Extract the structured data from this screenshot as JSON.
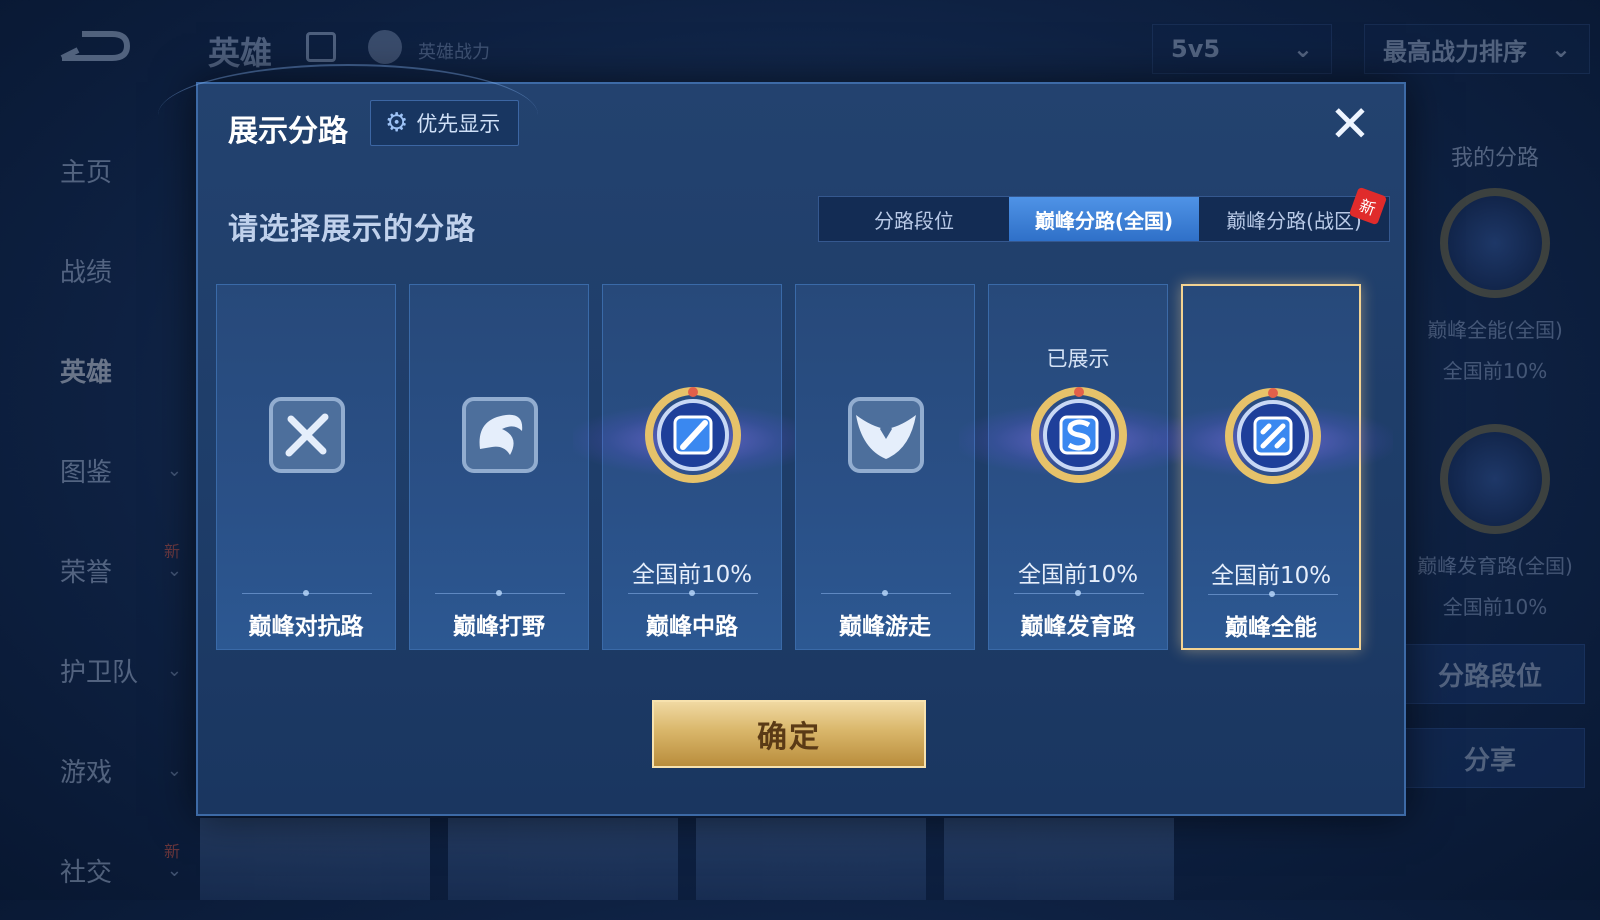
{
  "background": {
    "title": "英雄",
    "power_label": "英雄战力",
    "mode_select": "5v5",
    "sort_select": "最高战力排序",
    "sidebar": [
      {
        "label": "主页"
      },
      {
        "label": "战绩"
      },
      {
        "label": "英雄"
      },
      {
        "label": "图鉴"
      },
      {
        "label": "荣誉"
      },
      {
        "label": "护卫队"
      },
      {
        "label": "游戏"
      },
      {
        "label": "社交"
      }
    ],
    "new_tag": "新",
    "right_panel": {
      "my_lane_label": "我的分路",
      "badge1_name": "巅峰全能(全国)",
      "badge1_rank": "全国前10%",
      "badge2_name": "巅峰发育路(全国)",
      "badge2_rank": "全国前10%",
      "lane_rank_button": "分路段位",
      "share_button": "分享"
    }
  },
  "modal": {
    "title": "展示分路",
    "priority_button": "优先显示",
    "close_icon": "close-icon",
    "prompt": "请选择展示的分路",
    "tabs": [
      {
        "label": "分路段位",
        "active": false
      },
      {
        "label": "巅峰分路(全国)",
        "active": true
      },
      {
        "label": "巅峰分路(战区)",
        "active": false,
        "new": "新"
      }
    ],
    "cards": [
      {
        "name": "巅峰对抗路",
        "rank": "",
        "shown": "",
        "icon": "sword-cross-icon",
        "unlocked": false,
        "selected": false
      },
      {
        "name": "巅峰打野",
        "rank": "",
        "shown": "",
        "icon": "dragon-icon",
        "unlocked": false,
        "selected": false
      },
      {
        "name": "巅峰中路",
        "rank": "全国前10%",
        "shown": "",
        "icon": "mid-lane-badge-icon",
        "unlocked": true,
        "selected": false
      },
      {
        "name": "巅峰游走",
        "rank": "",
        "shown": "",
        "icon": "wings-icon",
        "unlocked": false,
        "selected": false
      },
      {
        "name": "巅峰发育路",
        "rank": "全国前10%",
        "shown": "已展示",
        "icon": "marksman-badge-icon",
        "unlocked": true,
        "selected": false
      },
      {
        "name": "巅峰全能",
        "rank": "全国前10%",
        "shown": "",
        "icon": "all-round-badge-icon",
        "unlocked": true,
        "selected": true
      }
    ],
    "confirm_button": "确定",
    "colors": {
      "accent_blue": "#3f86dd",
      "selected_border": "#f3d392",
      "gold": "#d9b66a",
      "new_tag": "#e02b2b"
    }
  }
}
